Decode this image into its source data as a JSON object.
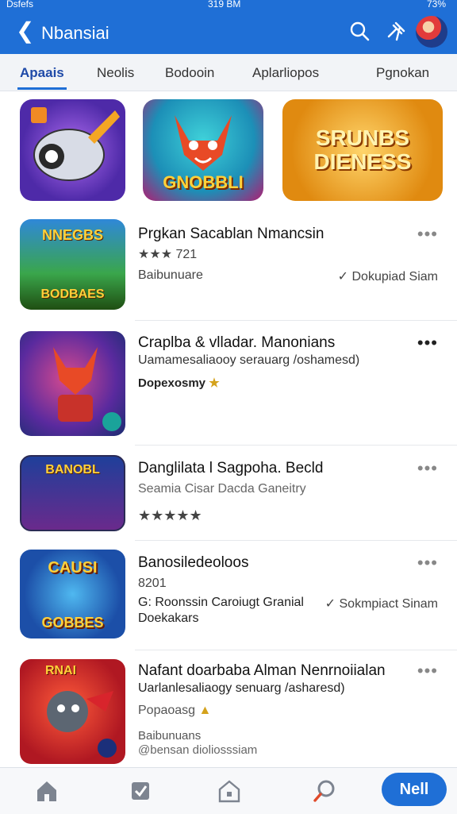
{
  "status_bar": {
    "left": "Dsfefs",
    "time": "319 BM",
    "battery": "73%"
  },
  "app_bar": {
    "title": "Nbansiai"
  },
  "tabs": [
    {
      "label": "Apaais"
    },
    {
      "label": "Neolis"
    },
    {
      "label": "Bodooin"
    },
    {
      "label": "Aplarliopos"
    },
    {
      "label": "Pgnokan"
    }
  ],
  "featured": [
    {
      "caption": ""
    },
    {
      "caption": "GNOBBLI"
    },
    {
      "caption": "SRUNBS DIENESS"
    }
  ],
  "list": [
    {
      "thumb_title": "NNEGBS",
      "thumb_caption": "BODBAES",
      "title": "Prgkan Sacablan Nmancsin",
      "rating": "★★★ 721",
      "line2": "Baibunuare",
      "right": "Dokupiad Siam"
    },
    {
      "thumb_title": "",
      "thumb_caption": "",
      "title": "Craplba & vlladar. Manonians",
      "line1": "Uamamesaliaooy serauarg /oshamesd)",
      "line2": "Dopexosmy"
    },
    {
      "thumb_title": "BANOBL",
      "thumb_caption": "",
      "title": "Danglilata l Sagpoha. Becld",
      "line1": "Seamia Cisar Dacda Ganeitry",
      "rating": "★★★★★"
    },
    {
      "thumb_title": "CAUSI",
      "thumb_caption": "GOBBES",
      "title": "Banosiledeoloos",
      "rating": "8201",
      "line1": "G: Roonssin Caroiugt Granial",
      "line2": "Doekakars",
      "right": "Sokmpiact Sinam"
    },
    {
      "thumb_title": "RNAI",
      "thumb_caption": "",
      "title": "Nafant doarbaba Alman Nenrnoiialan",
      "line1": "Uarlanlesaliaogy senuarg /asharesd)",
      "line2": "Popaoasg",
      "line3": "Baibunuans",
      "line4": "@bensan dioliosssiam"
    }
  ],
  "bottom_nav": {
    "next_label": "Nell"
  },
  "colors": {
    "accent": "#1f6fd6",
    "star": "#f1b51c"
  }
}
